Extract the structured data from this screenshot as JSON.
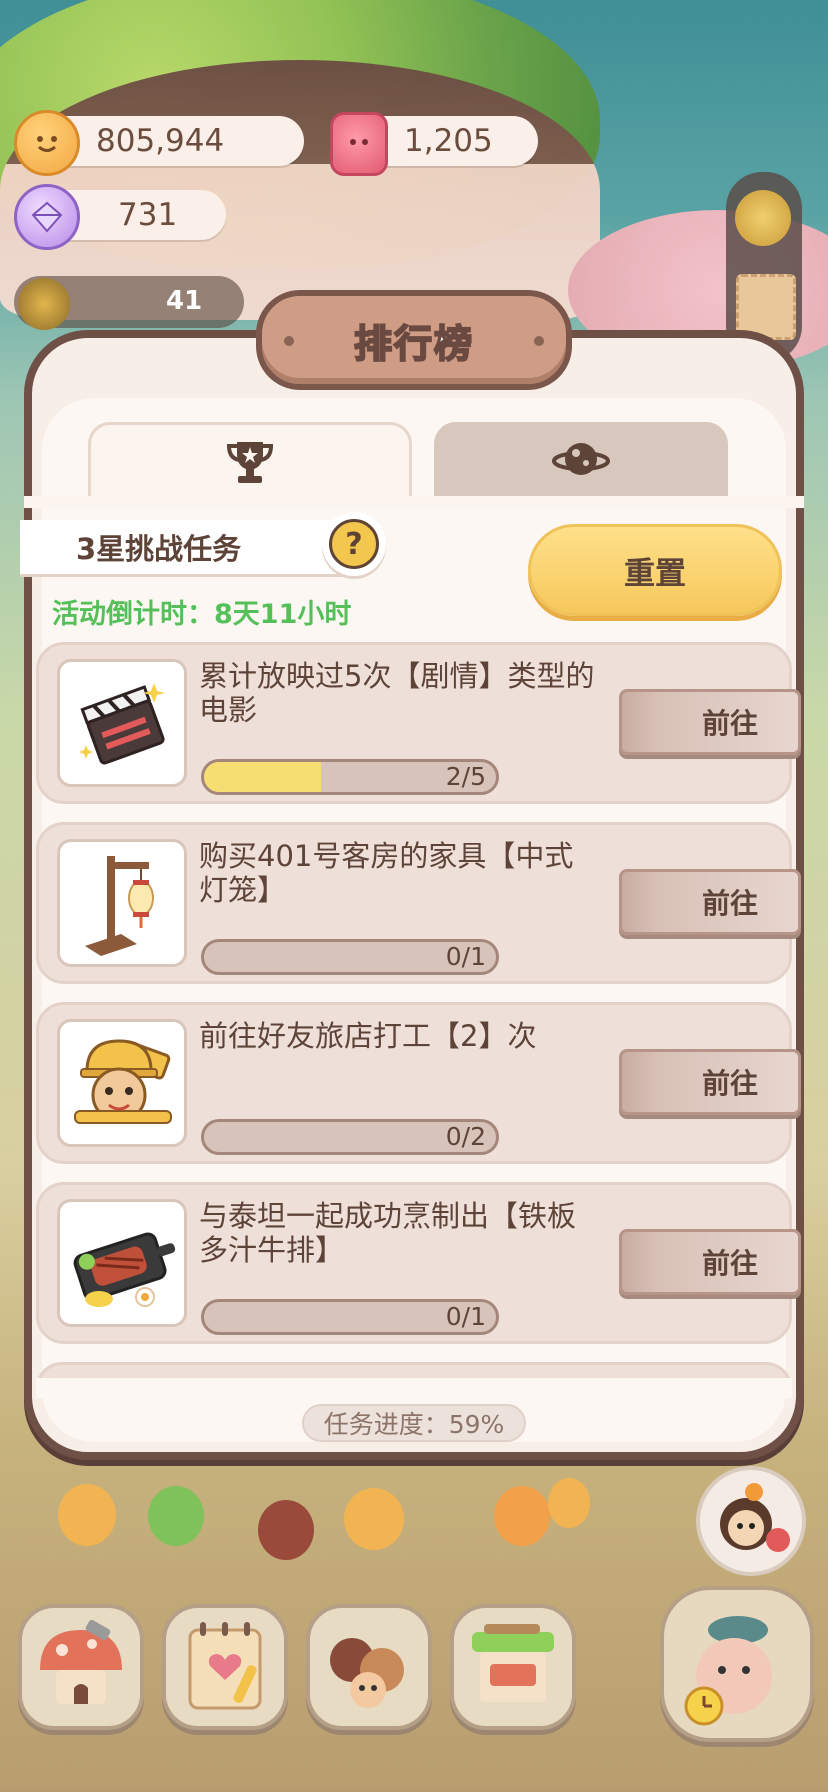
{
  "resources": {
    "cookies": "805,944",
    "candles": "1,205",
    "gems": "731",
    "hidden_counter": "41"
  },
  "leaderboard": {
    "title": "排行榜",
    "tabs": [
      {
        "icon": "trophy-icon",
        "active": true
      },
      {
        "icon": "planet-icon",
        "active": false
      }
    ]
  },
  "challenge": {
    "label": "3星挑战任务",
    "help_symbol": "?",
    "reset_label": "重置",
    "countdown": "活动倒计时：8天11小时"
  },
  "quests": [
    {
      "text": "累计放映过5次【剧情】类型的电影",
      "progress_text": "2/5",
      "progress": 0.4,
      "button": "前往",
      "icon": "clapperboard-icon"
    },
    {
      "text": "购买401号客房的家具【中式灯笼】",
      "progress_text": "0/1",
      "progress": 0,
      "button": "前往",
      "icon": "lantern-icon"
    },
    {
      "text": "前往好友旅店打工【2】次",
      "progress_text": "0/2",
      "progress": 0,
      "button": "前往",
      "icon": "worker-cookie-icon"
    },
    {
      "text": "与泰坦一起成功烹制出【铁板多汁牛排】",
      "progress_text": "0/1",
      "progress": 0,
      "button": "前往",
      "icon": "steak-icon"
    }
  ],
  "task_progress": "任务进度：59%",
  "colors": {
    "accent_yellow": "#f6c85c",
    "countdown_green": "#55c05a",
    "panel_border": "#6f5047",
    "text_brown": "#5e4438"
  }
}
